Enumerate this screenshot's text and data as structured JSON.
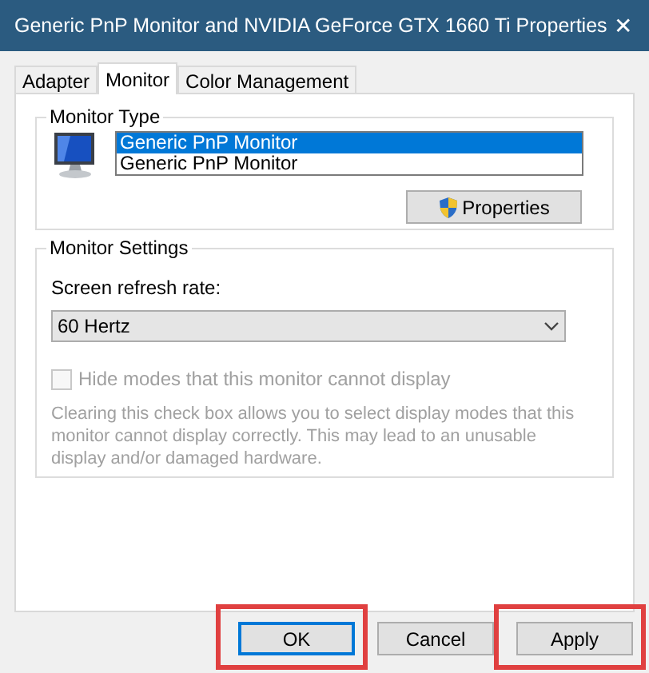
{
  "window": {
    "title": "Generic PnP Monitor and NVIDIA GeForce GTX 1660 Ti Properties",
    "close": "✕"
  },
  "tabs": [
    {
      "label": "Adapter",
      "selected": false
    },
    {
      "label": "Monitor",
      "selected": true
    },
    {
      "label": "Color Management",
      "selected": false
    }
  ],
  "monitor_type": {
    "title": "Monitor Type",
    "monitors": [
      {
        "label": "Generic PnP Monitor",
        "selected": true
      },
      {
        "label": "Generic PnP Monitor",
        "selected": false
      }
    ],
    "properties_button": "Properties"
  },
  "monitor_settings": {
    "title": "Monitor Settings",
    "refresh_label": "Screen refresh rate:",
    "refresh_value": "60 Hertz",
    "hide_modes": {
      "label": "Hide modes that this monitor cannot display",
      "checked": false,
      "disabled": true
    },
    "description": "Clearing this check box allows you to select display modes that this monitor cannot display correctly. This may lead to an unusable display and/or damaged hardware."
  },
  "buttons": [
    {
      "label": "OK",
      "default": true,
      "highlighted": true
    },
    {
      "label": "Cancel",
      "default": false,
      "highlighted": false
    },
    {
      "label": "Apply",
      "default": false,
      "highlighted": true
    }
  ]
}
